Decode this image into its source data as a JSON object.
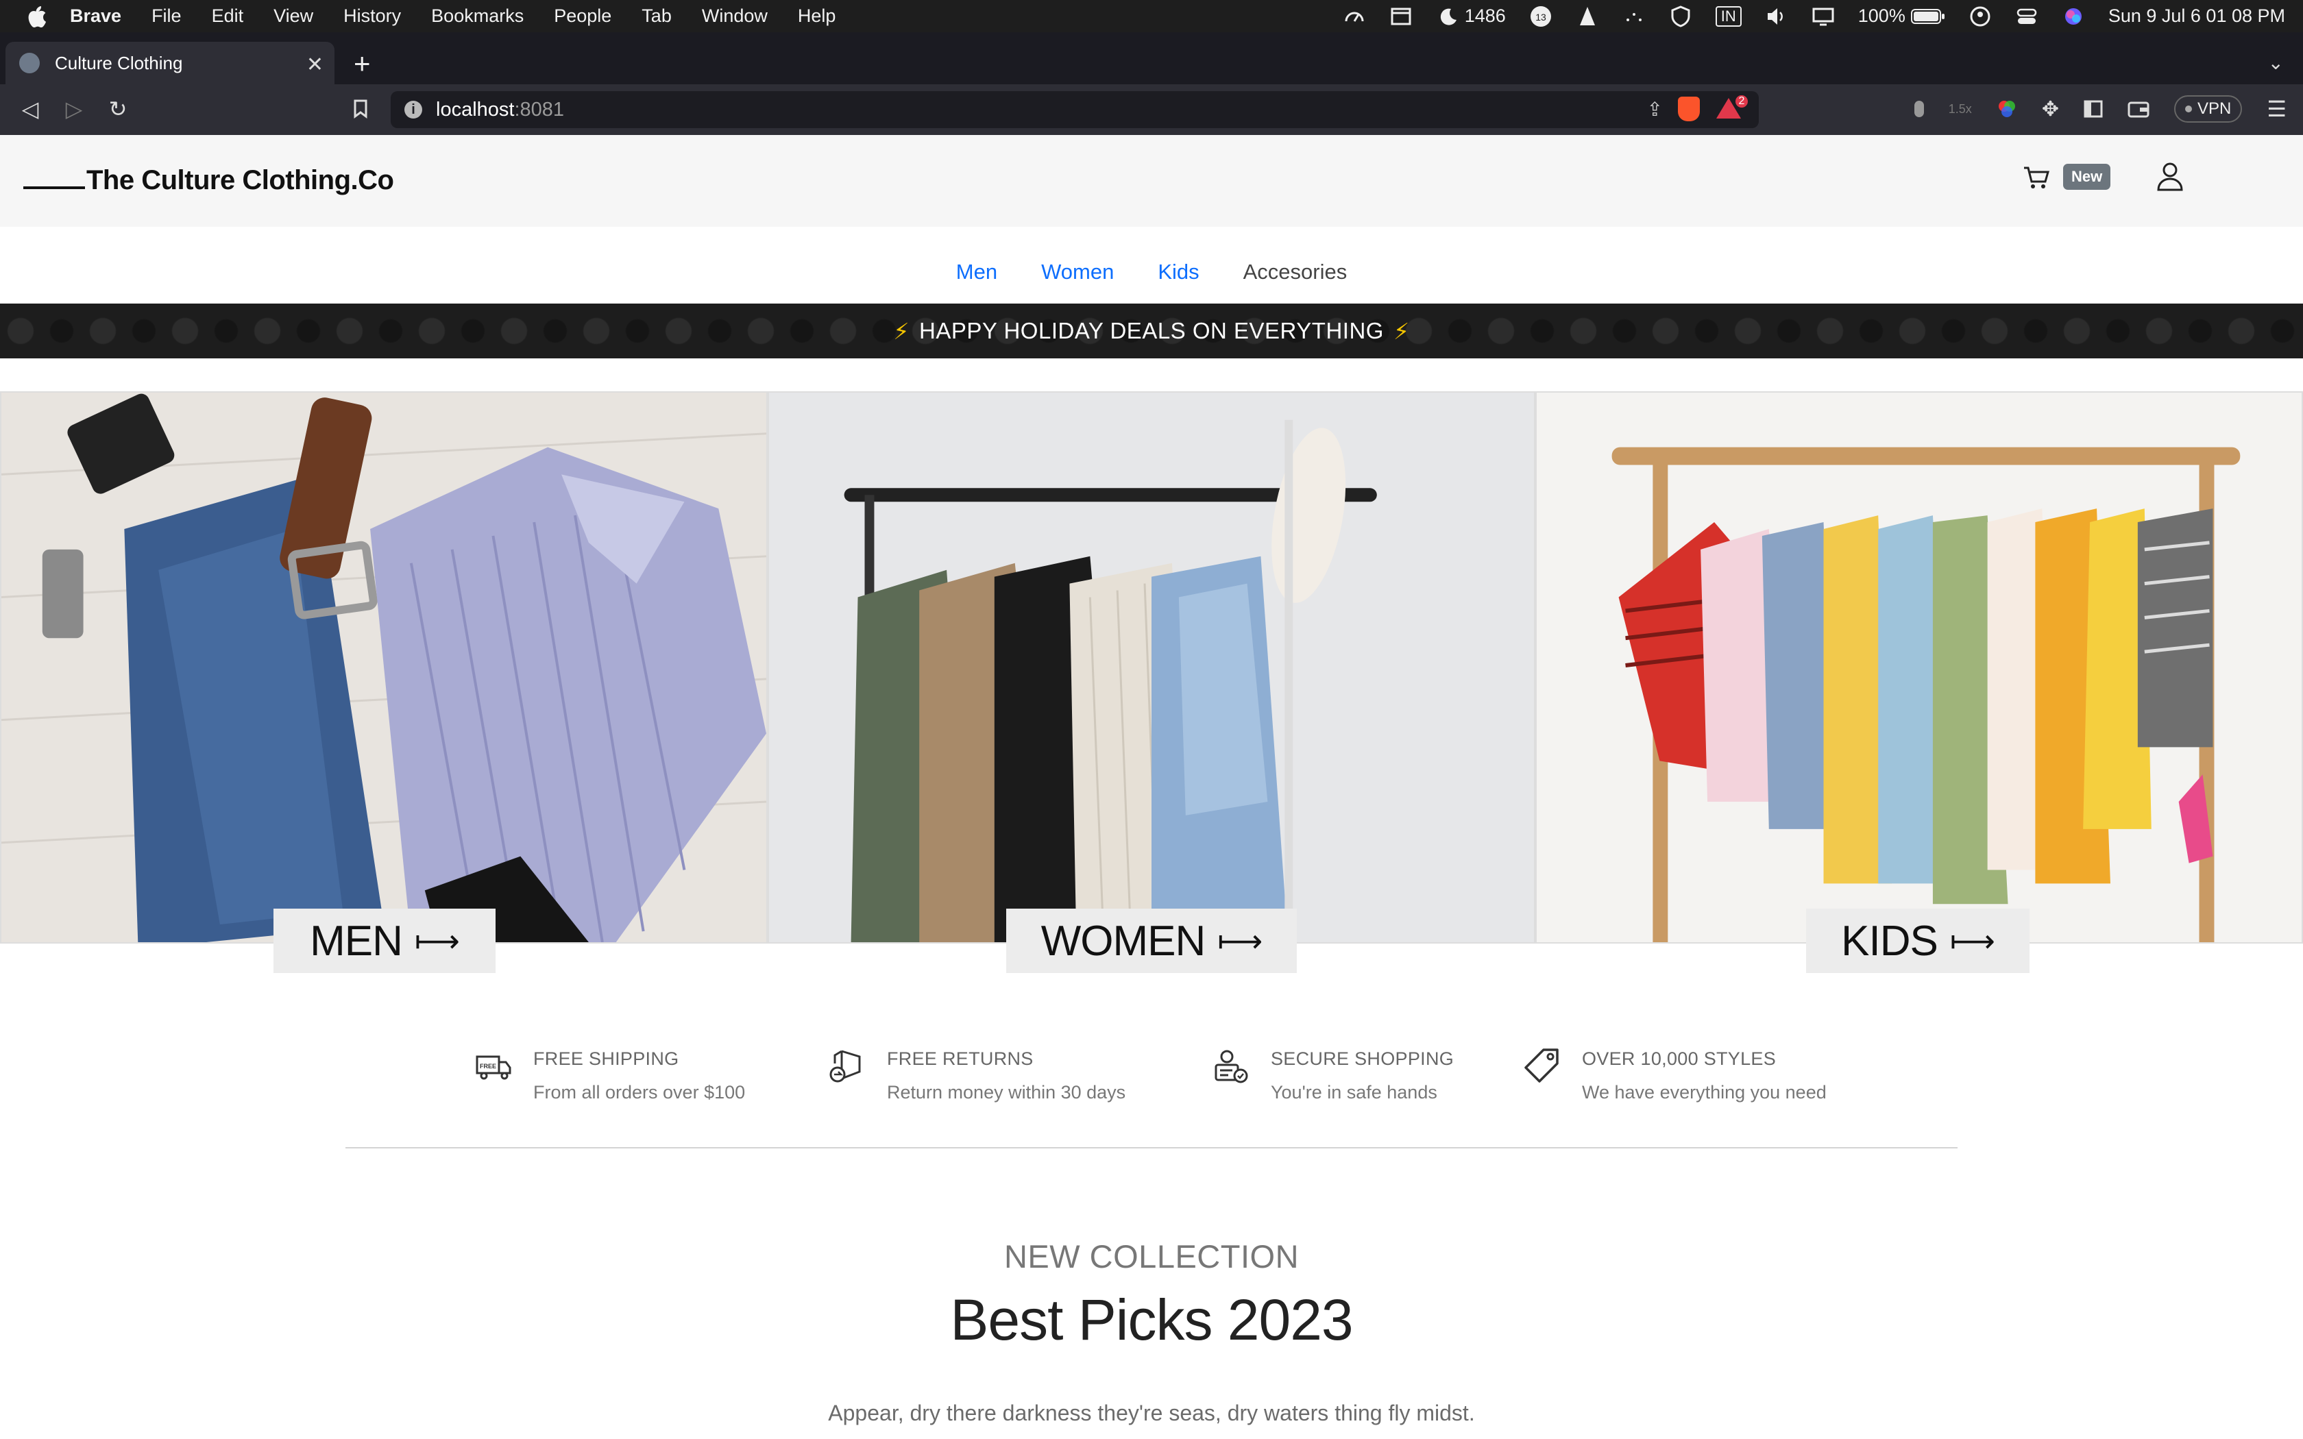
{
  "menubar": {
    "app": "Brave",
    "items": [
      "File",
      "Edit",
      "View",
      "History",
      "Bookmarks",
      "People",
      "Tab",
      "Window",
      "Help"
    ],
    "status": {
      "moon_count": "1486",
      "badge_13": "13",
      "input_source": "IN",
      "battery": "100%",
      "clock": "Sun 9 Jul  6 01 08 PM"
    }
  },
  "browser": {
    "tab_title": "Culture Clothing",
    "url_host": "localhost",
    "url_port": ":8081",
    "zoom": "1.5x",
    "rewards_badge": "2",
    "vpn_label": "VPN"
  },
  "site": {
    "logo": "The Culture Clothing.Co",
    "cart_badge": "New",
    "nav": [
      "Men",
      "Women",
      "Kids",
      "Accesories"
    ],
    "promo": "HAPPY HOLIDAY DEALS ON EVERYTHING",
    "bolt": "⚡",
    "hero": [
      {
        "label": "MEN",
        "arrow": "⟼"
      },
      {
        "label": "WOMEN",
        "arrow": "⟼"
      },
      {
        "label": "KIDS",
        "arrow": "⟼"
      }
    ],
    "features": [
      {
        "title": "FREE SHIPPING",
        "subtitle": "From all orders over $100",
        "icon": "free-shipping-truck-icon"
      },
      {
        "title": "FREE RETURNS",
        "subtitle": "Return money within 30 days",
        "icon": "return-box-icon"
      },
      {
        "title": "SECURE SHOPPING",
        "subtitle": "You're in safe hands",
        "icon": "secure-user-icon"
      },
      {
        "title": "OVER 10,000 STYLES",
        "subtitle": "We have everything you need",
        "icon": "price-tag-icon"
      }
    ],
    "collection": {
      "eyebrow": "NEW COLLECTION",
      "heading": "Best Picks 2023",
      "lead": "Appear, dry there darkness they're seas, dry waters thing fly midst."
    }
  },
  "colors": {
    "link": "#0d6efd",
    "promo_bg": "#1d1d1d",
    "badge_bg": "#6c757d",
    "bolt": "#f7c600"
  }
}
